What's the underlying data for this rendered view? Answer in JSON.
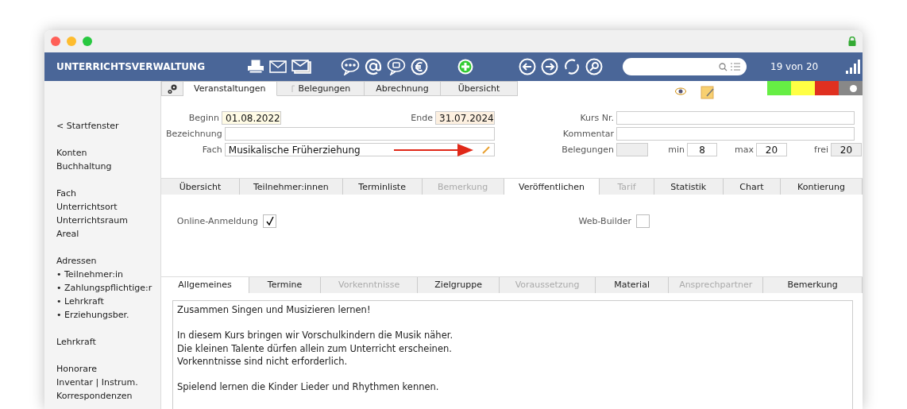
{
  "app": {
    "title": "UNTERRICHTSVERWALTUNG",
    "record_counter": "19 von 20"
  },
  "sidebar": {
    "groups": [
      [
        {
          "label": "< Startfenster"
        }
      ],
      [
        {
          "label": "Konten"
        },
        {
          "label": "Buchhaltung"
        }
      ],
      [
        {
          "label": "Fach"
        },
        {
          "label": "Unterrichtsort"
        },
        {
          "label": "Unterrichtsraum"
        },
        {
          "label": "Areal"
        }
      ],
      [
        {
          "label": "Adressen"
        },
        {
          "label": "• Teilnehmer:in"
        },
        {
          "label": "• Zahlungspflichtige:r"
        },
        {
          "label": "• Lehrkraft"
        },
        {
          "label": "• Erziehungsber."
        }
      ],
      [
        {
          "label": "Lehrkraft"
        }
      ],
      [
        {
          "label": "Honorare"
        },
        {
          "label": "Inventar | Instrum."
        },
        {
          "label": "Korrespondenzen"
        }
      ]
    ]
  },
  "main_tabs": [
    {
      "label": "Veranstaltungen",
      "selected": true
    },
    {
      "label": "Belegungen",
      "selected": false
    },
    {
      "label": "Abrechnung",
      "selected": false
    },
    {
      "label": "Übersicht",
      "selected": false
    }
  ],
  "status_swatches": [
    {
      "color": "#66ee44"
    },
    {
      "color": "#ffff44"
    },
    {
      "color": "#e03020"
    }
  ],
  "status_toggle": {
    "on": false
  },
  "form": {
    "beginn": {
      "label": "Beginn",
      "value": "01.08.2022"
    },
    "ende": {
      "label": "Ende",
      "value": "31.07.2024"
    },
    "bezeichnung": {
      "label": "Bezeichnung"
    },
    "fach": {
      "label": "Fach",
      "value": "Musikalische Früherziehung"
    },
    "kurs_nr": {
      "label": "Kurs Nr."
    },
    "kommentar": {
      "label": "Kommentar"
    },
    "belegungen": {
      "label": "Belegungen"
    },
    "min": {
      "label": "min",
      "value": "8"
    },
    "max": {
      "label": "max",
      "value": "20"
    },
    "frei": {
      "label": "frei",
      "value": "20"
    }
  },
  "detail_tabs": [
    {
      "label": "Übersicht",
      "selected": false,
      "disabled": false
    },
    {
      "label": "Teilnehmer:innen",
      "selected": false,
      "disabled": false
    },
    {
      "label": "Terminliste",
      "selected": false,
      "disabled": false
    },
    {
      "label": "Bemerkung",
      "selected": false,
      "disabled": true
    },
    {
      "label": "Veröffentlichen",
      "selected": true,
      "disabled": false
    },
    {
      "label": "Tarif",
      "selected": false,
      "disabled": true
    },
    {
      "label": "Statistik",
      "selected": false,
      "disabled": false
    },
    {
      "label": "Chart",
      "selected": false,
      "disabled": false
    },
    {
      "label": "Kontierung",
      "selected": false,
      "disabled": false
    }
  ],
  "publish": {
    "online_anmeldung": {
      "label": "Online-Anmeldung",
      "checked": true
    },
    "web_builder": {
      "label": "Web-Builder",
      "checked": false
    }
  },
  "text_tabs": [
    {
      "label": "Allgemeines",
      "selected": true,
      "disabled": false
    },
    {
      "label": "Termine",
      "selected": false,
      "disabled": false
    },
    {
      "label": "Vorkenntnisse",
      "selected": false,
      "disabled": true
    },
    {
      "label": "Zielgruppe",
      "selected": false,
      "disabled": false
    },
    {
      "label": "Voraussetzung",
      "selected": false,
      "disabled": true
    },
    {
      "label": "Material",
      "selected": false,
      "disabled": false
    },
    {
      "label": "Ansprechpartner",
      "selected": false,
      "disabled": true
    },
    {
      "label": "Bemerkung",
      "selected": false,
      "disabled": false
    }
  ],
  "description": [
    [
      "Zusammen Singen und Musizieren lernen!"
    ],
    [
      "In diesem Kurs bringen wir Vorschulkindern die Musik näher.",
      "Die kleinen Talente dürfen allein zum Unterricht erscheinen.",
      "Vorkenntnisse sind nicht erforderlich."
    ],
    [
      "Spielend lernen die Kinder Lieder und Rhythmen kennen."
    ]
  ]
}
